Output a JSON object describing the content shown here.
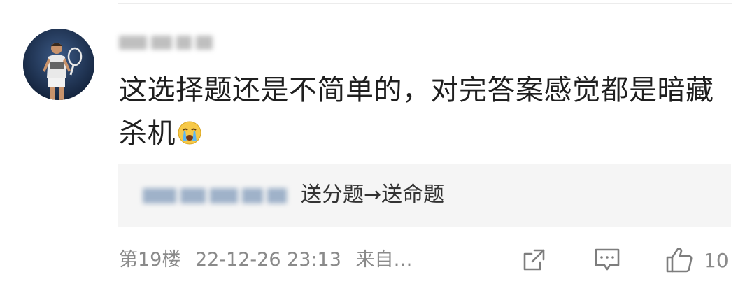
{
  "comment": {
    "avatar_icon": "tennis-player-avatar",
    "username_state": "blurred",
    "text": "这选择题还是不简单的，对完答案感觉都是暗藏杀机",
    "emoji": "crying-face-emoji"
  },
  "quote": {
    "user_state": "blurred",
    "text": "送分题→送命题"
  },
  "footer": {
    "floor": "第19楼",
    "datetime": "22-12-26 23:13",
    "source": "来自…",
    "actions": {
      "share_icon": "share-icon",
      "reply_icon": "comment-icon",
      "like_icon": "thumbs-up-icon",
      "like_count": "10"
    }
  },
  "colors": {
    "text_primary": "#1f1f1f",
    "text_secondary": "#8a8a8a",
    "quote_bg": "#f5f5f5",
    "divider": "#ececec"
  }
}
